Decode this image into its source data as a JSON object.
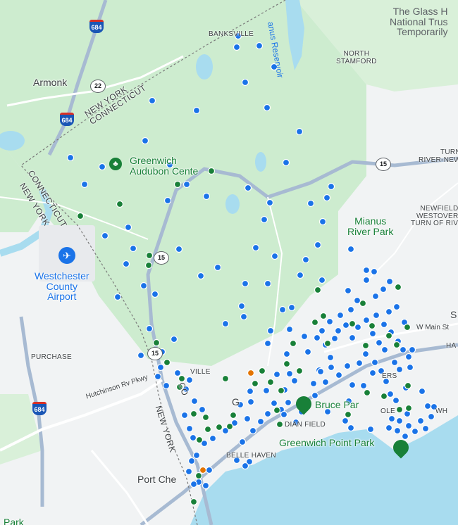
{
  "map": {
    "labels": {
      "armonk": "Armonk",
      "banksville": "BANKSVILLE",
      "north_stamford": "NORTH\nSTAMFORD",
      "glass_house": "The Glass H\nNational Trus\nTemporarily",
      "mianus_reservoir": "anus Reservoir",
      "greenwich_audubon": "Greenwich\nAudubon Cente",
      "mianus_river_park": "Mianus\nRiver Park",
      "newfield": "NEWFIELD -\nWESTOVER -\nTURN OF RIVE",
      "turn_river": "TURN\nRIVER-NEW",
      "westchester_airport": "Westchester\nCounty\nAirport",
      "purchase": "PURCHASE",
      "bruce_park": "Bruce Par",
      "greenwich_point_park": "Greenwich Point Park",
      "belle_haven": "BELLE HAVEN",
      "dian_field": "DIAN FIELD",
      "port_chester": "Port Che",
      "park_bottom": "Park",
      "w_main_st": "W Main St",
      "hutchinson_pkwy": "Hutchinson Rv Pkwy",
      "ny_ct_top": "NEW YORK\nCONNECTICUT",
      "ct_ny_left_ct": "CONNECTICUT",
      "ct_ny_left_ny": "NEW YORK",
      "new_york_bottom": "NEW YORK",
      "co_vert": "CO",
      "ville": "VILLE",
      "g_fragment": "G",
      "ole_fragment": "OLE",
      "wh_fragment": "WH",
      "s_fragment": "S",
      "ha_fragment": "HA",
      "e_fragment": "ERS"
    },
    "shields": [
      {
        "type": "interstate",
        "label": "684"
      },
      {
        "type": "interstate",
        "label": "684"
      },
      {
        "type": "interstate",
        "label": "684"
      },
      {
        "type": "state",
        "label": "22"
      },
      {
        "type": "state",
        "label": "15"
      },
      {
        "type": "state",
        "label": "15"
      },
      {
        "type": "state",
        "label": "15"
      }
    ],
    "colors": {
      "land": "#f1f3f4",
      "forest": "#cdeccf",
      "water": "#a8dcef",
      "highway": "#a7bad2",
      "road": "#ffffff",
      "marker_blue": "#1a73e8",
      "marker_green": "#188038",
      "marker_orange": "#e37400",
      "border_line": "#7a7a7a"
    },
    "marker_legend": {
      "blue": "marker-blue",
      "green": "marker-green",
      "orange": "marker-orange"
    },
    "icons": [
      "airport-icon",
      "park-pin-icon"
    ]
  }
}
